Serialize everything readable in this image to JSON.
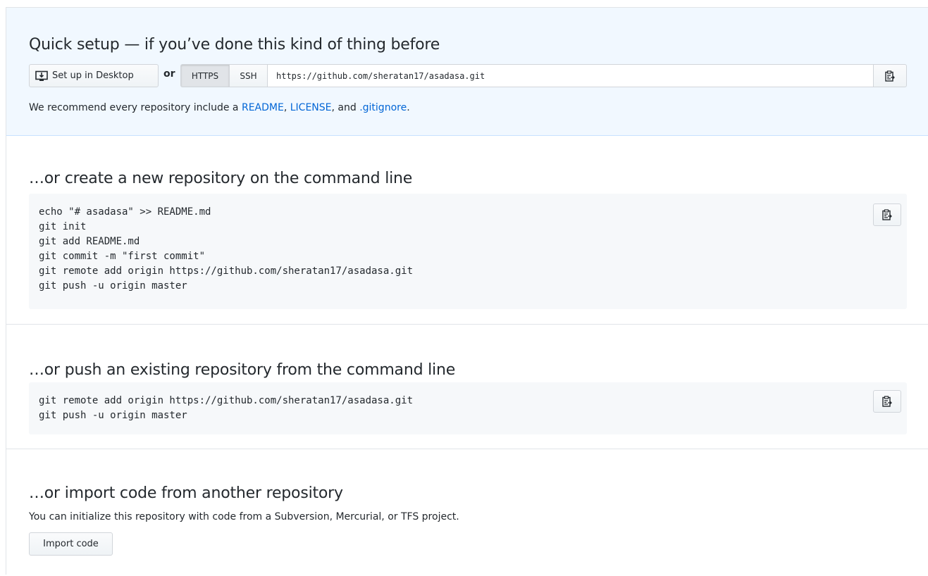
{
  "quick_setup": {
    "title": "Quick setup — if you’ve done this kind of thing before",
    "desktop_button": "Set up in Desktop",
    "or_label": "or",
    "protocols": [
      "HTTPS",
      "SSH"
    ],
    "selected_protocol": "HTTPS",
    "clone_url": "https://github.com/sheratan17/asadasa.git",
    "recommend": {
      "prefix": "We recommend every repository include a ",
      "readme": "README",
      "sep1": ", ",
      "license": "LICENSE",
      "sep2": ", and ",
      "gitignore": ".gitignore",
      "suffix": "."
    },
    "icons": {
      "desktop": "desktop-download-icon",
      "copy": "clippy-icon"
    }
  },
  "create_section": {
    "title": "…or create a new repository on the command line",
    "code": "echo \"# asadasa\" >> README.md\ngit init\ngit add README.md\ngit commit -m \"first commit\"\ngit remote add origin https://github.com/sheratan17/asadasa.git\ngit push -u origin master"
  },
  "push_section": {
    "title": "…or push an existing repository from the command line",
    "code": "git remote add origin https://github.com/sheratan17/asadasa.git\ngit push -u origin master"
  },
  "import_section": {
    "title": "…or import code from another repository",
    "description": "You can initialize this repository with code from a Subversion, Mercurial, or TFS project.",
    "button": "Import code"
  },
  "colors": {
    "quick_bg": "#f1f8ff",
    "link": "#0366d6",
    "code_bg": "#f6f8fa",
    "border": "#e1e4e8"
  }
}
